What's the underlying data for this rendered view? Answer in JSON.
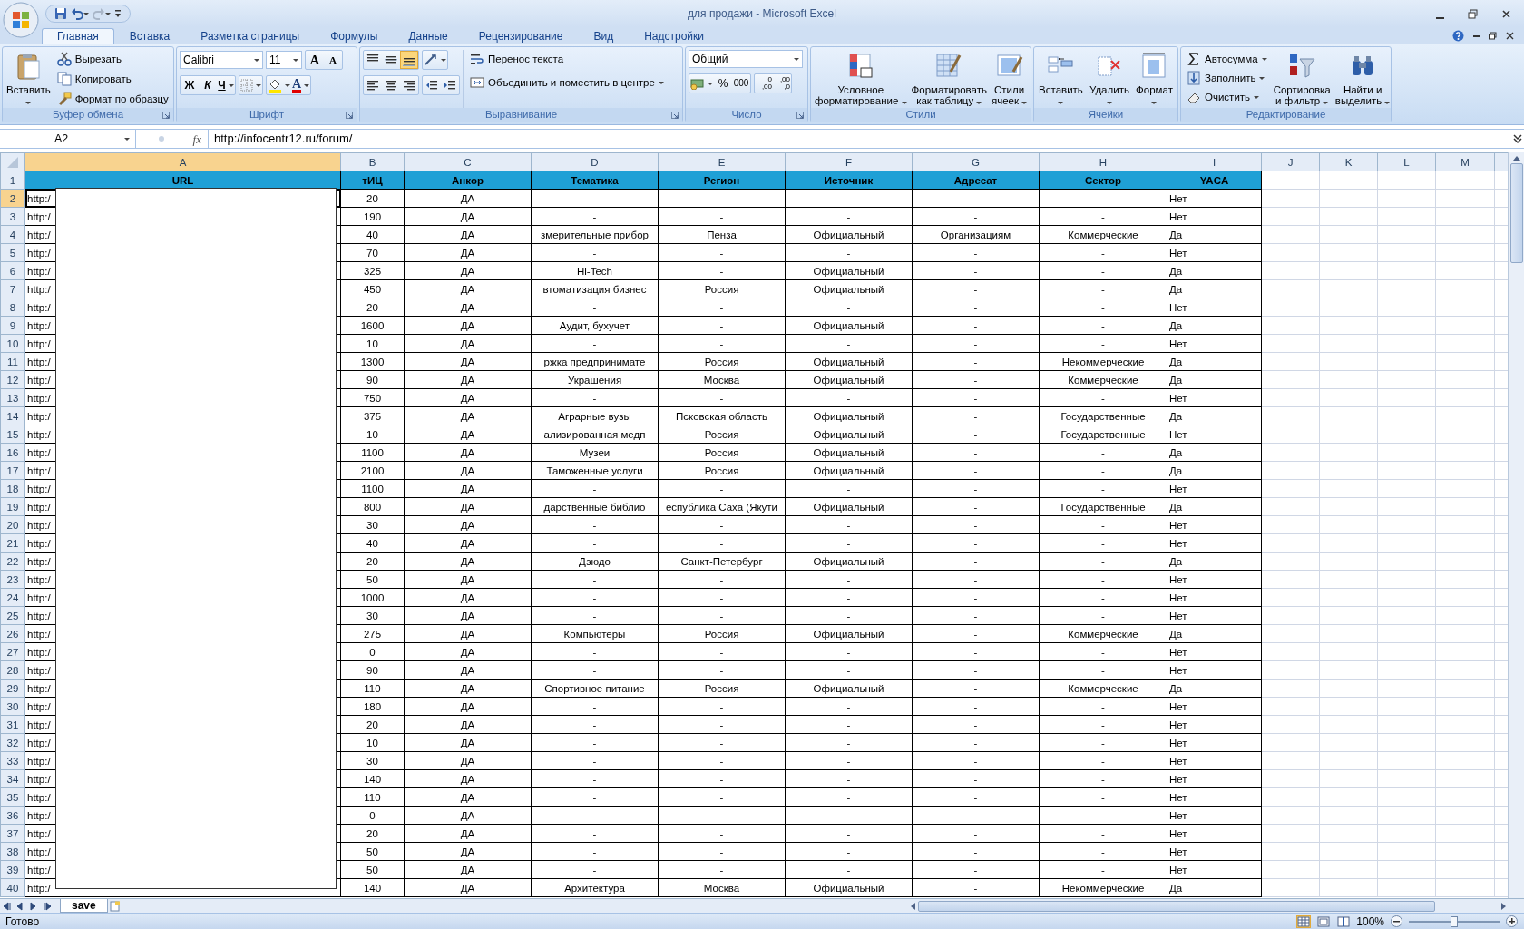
{
  "title_bar": {
    "title": "для продажи - Microsoft Excel"
  },
  "tabs": [
    {
      "label": "Главная",
      "selected": true
    },
    {
      "label": "Вставка",
      "selected": false
    },
    {
      "label": "Разметка страницы",
      "selected": false
    },
    {
      "label": "Формулы",
      "selected": false
    },
    {
      "label": "Данные",
      "selected": false
    },
    {
      "label": "Рецензирование",
      "selected": false
    },
    {
      "label": "Вид",
      "selected": false
    },
    {
      "label": "Надстройки",
      "selected": false
    }
  ],
  "ribbon": {
    "clipboard": {
      "label": "Буфер обмена",
      "paste": "Вставить",
      "commands": [
        "Вырезать",
        "Копировать",
        "Формат по образцу"
      ]
    },
    "font": {
      "label": "Шрифт",
      "font_name": "Calibri",
      "font_size": "11",
      "grow": "A",
      "shrink": "A",
      "bold": "Ж",
      "italic": "К",
      "underline": "Ч",
      "color_letter": "A"
    },
    "alignment": {
      "label": "Выравнивание",
      "vertical_align": [
        {
          "selected": false
        },
        {
          "selected": false
        },
        {
          "selected": true
        }
      ],
      "wrap": "Перенос текста",
      "merge": "Объединить и поместить в центре"
    },
    "number": {
      "label": "Число",
      "format": "Общий",
      "percent": "%",
      "thousands": "000",
      "increase": [
        ",0",
        ",00"
      ],
      "decrease": [
        ",00",
        ",0"
      ]
    },
    "styles": {
      "label": "Стили",
      "commands": [
        [
          "Условное",
          "форматирование"
        ],
        [
          "Форматировать",
          "как таблицу"
        ],
        [
          "Стили",
          "ячеек"
        ]
      ]
    },
    "cells": {
      "label": "Ячейки",
      "commands": [
        "Вставить",
        "Удалить",
        "Формат"
      ]
    },
    "editing": {
      "label": "Редактирование",
      "commands": [
        "Автосумма",
        "Заполнить",
        "Очистить"
      ],
      "large": [
        [
          "Сортировка",
          "и фильтр"
        ],
        [
          "Найти и",
          "выделить"
        ]
      ]
    }
  },
  "formula_bar": {
    "name_box": "A2",
    "fx": "fx",
    "value": "http://infocentr12.ru/forum/"
  },
  "columns": [
    {
      "label": "A",
      "selected": true
    },
    {
      "label": "B",
      "selected": false
    },
    {
      "label": "C",
      "selected": false
    },
    {
      "label": "D",
      "selected": false
    },
    {
      "label": "E",
      "selected": false
    },
    {
      "label": "F",
      "selected": false
    },
    {
      "label": "G",
      "selected": false
    },
    {
      "label": "H",
      "selected": false
    },
    {
      "label": "I",
      "selected": false
    },
    {
      "label": "J",
      "selected": false
    },
    {
      "label": "K",
      "selected": false
    },
    {
      "label": "L",
      "selected": false
    },
    {
      "label": "M",
      "selected": false
    }
  ],
  "header_row": {
    "number": "1",
    "cells": [
      "URL",
      "тИЦ",
      "Анкор",
      "Тематика",
      "Регион",
      "Источник",
      "Адресат",
      "Сектор",
      "YACA"
    ]
  },
  "rows": [
    {
      "number": "2",
      "selected": true,
      "cells": [
        "http:/",
        "20",
        "ДА",
        "-",
        "-",
        "-",
        "-",
        "-",
        "Нет"
      ]
    },
    {
      "number": "3",
      "selected": false,
      "cells": [
        "http:/",
        "190",
        "ДА",
        "-",
        "-",
        "-",
        "-",
        "-",
        "Нет"
      ]
    },
    {
      "number": "4",
      "selected": false,
      "cells": [
        "http:/",
        "40",
        "ДА",
        "змерительные прибор",
        "Пенза",
        "Официальный",
        "Организациям",
        "Коммерческие",
        "Да"
      ]
    },
    {
      "number": "5",
      "selected": false,
      "cells": [
        "http:/",
        "70",
        "ДА",
        "-",
        "-",
        "-",
        "-",
        "-",
        "Нет"
      ]
    },
    {
      "number": "6",
      "selected": false,
      "cells": [
        "http:/",
        "325",
        "ДА",
        "Hi-Tech",
        "-",
        "Официальный",
        "-",
        "-",
        "Да"
      ]
    },
    {
      "number": "7",
      "selected": false,
      "cells": [
        "http:/",
        "450",
        "ДА",
        "втоматизация бизнес",
        "Россия",
        "Официальный",
        "-",
        "-",
        "Да"
      ]
    },
    {
      "number": "8",
      "selected": false,
      "cells": [
        "http:/",
        "20",
        "ДА",
        "-",
        "-",
        "-",
        "-",
        "-",
        "Нет"
      ]
    },
    {
      "number": "9",
      "selected": false,
      "cells": [
        "http:/",
        "1600",
        "ДА",
        "Аудит, бухучет",
        "-",
        "Официальный",
        "-",
        "-",
        "Да"
      ]
    },
    {
      "number": "10",
      "selected": false,
      "cells": [
        "http:/",
        "10",
        "ДА",
        "-",
        "-",
        "-",
        "-",
        "-",
        "Нет"
      ]
    },
    {
      "number": "11",
      "selected": false,
      "cells": [
        "http:/",
        "1300",
        "ДА",
        "ржка предпринимате",
        "Россия",
        "Официальный",
        "-",
        "Некоммерческие",
        "Да"
      ]
    },
    {
      "number": "12",
      "selected": false,
      "cells": [
        "http:/",
        "90",
        "ДА",
        "Украшения",
        "Москва",
        "Официальный",
        "-",
        "Коммерческие",
        "Да"
      ]
    },
    {
      "number": "13",
      "selected": false,
      "cells": [
        "http:/",
        "750",
        "ДА",
        "-",
        "-",
        "-",
        "-",
        "-",
        "Нет"
      ]
    },
    {
      "number": "14",
      "selected": false,
      "cells": [
        "http:/",
        "375",
        "ДА",
        "Аграрные вузы",
        "Псковская область",
        "Официальный",
        "-",
        "Государственные",
        "Да"
      ]
    },
    {
      "number": "15",
      "selected": false,
      "cells": [
        "http:/",
        "10",
        "ДА",
        "ализированная медп",
        "Россия",
        "Официальный",
        "-",
        "Государственные",
        "Нет"
      ]
    },
    {
      "number": "16",
      "selected": false,
      "cells": [
        "http:/",
        "1100",
        "ДА",
        "Музеи",
        "Россия",
        "Официальный",
        "-",
        "-",
        "Да"
      ]
    },
    {
      "number": "17",
      "selected": false,
      "cells": [
        "http:/",
        "2100",
        "ДА",
        "Таможенные услуги",
        "Россия",
        "Официальный",
        "-",
        "-",
        "Да"
      ]
    },
    {
      "number": "18",
      "selected": false,
      "cells": [
        "http:/",
        "1100",
        "ДА",
        "-",
        "-",
        "-",
        "-",
        "-",
        "Нет"
      ]
    },
    {
      "number": "19",
      "selected": false,
      "cells": [
        "http:/",
        "800",
        "ДА",
        "дарственные  библио",
        "еспублика Саха (Якути",
        "Официальный",
        "-",
        "Государственные",
        "Да"
      ]
    },
    {
      "number": "20",
      "selected": false,
      "cells": [
        "http:/",
        "30",
        "ДА",
        "-",
        "-",
        "-",
        "-",
        "-",
        "Нет"
      ]
    },
    {
      "number": "21",
      "selected": false,
      "cells": [
        "http:/",
        "40",
        "ДА",
        "-",
        "-",
        "-",
        "-",
        "-",
        "Нет"
      ]
    },
    {
      "number": "22",
      "selected": false,
      "cells": [
        "http:/",
        "20",
        "ДА",
        "Дзюдо",
        "Санкт-Петербург",
        "Официальный",
        "-",
        "-",
        "Да"
      ]
    },
    {
      "number": "23",
      "selected": false,
      "cells": [
        "http:/",
        "50",
        "ДА",
        "-",
        "-",
        "-",
        "-",
        "-",
        "Нет"
      ]
    },
    {
      "number": "24",
      "selected": false,
      "cells": [
        "http:/",
        "1000",
        "ДА",
        "-",
        "-",
        "-",
        "-",
        "-",
        "Нет"
      ]
    },
    {
      "number": "25",
      "selected": false,
      "cells": [
        "http:/",
        "30",
        "ДА",
        "-",
        "-",
        "-",
        "-",
        "-",
        "Нет"
      ]
    },
    {
      "number": "26",
      "selected": false,
      "cells": [
        "http:/",
        "275",
        "ДА",
        "Компьютеры",
        "Россия",
        "Официальный",
        "-",
        "Коммерческие",
        "Да"
      ]
    },
    {
      "number": "27",
      "selected": false,
      "cells": [
        "http:/",
        "0",
        "ДА",
        "-",
        "-",
        "-",
        "-",
        "-",
        "Нет"
      ]
    },
    {
      "number": "28",
      "selected": false,
      "cells": [
        "http:/",
        "90",
        "ДА",
        "-",
        "-",
        "-",
        "-",
        "-",
        "Нет"
      ]
    },
    {
      "number": "29",
      "selected": false,
      "cells": [
        "http:/",
        "110",
        "ДА",
        "Спортивное питание",
        "Россия",
        "Официальный",
        "-",
        "Коммерческие",
        "Да"
      ]
    },
    {
      "number": "30",
      "selected": false,
      "cells": [
        "http:/",
        "180",
        "ДА",
        "-",
        "-",
        "-",
        "-",
        "-",
        "Нет"
      ]
    },
    {
      "number": "31",
      "selected": false,
      "cells": [
        "http:/",
        "20",
        "ДА",
        "-",
        "-",
        "-",
        "-",
        "-",
        "Нет"
      ]
    },
    {
      "number": "32",
      "selected": false,
      "cells": [
        "http:/",
        "10",
        "ДА",
        "-",
        "-",
        "-",
        "-",
        "-",
        "Нет"
      ]
    },
    {
      "number": "33",
      "selected": false,
      "cells": [
        "http:/",
        "30",
        "ДА",
        "-",
        "-",
        "-",
        "-",
        "-",
        "Нет"
      ]
    },
    {
      "number": "34",
      "selected": false,
      "cells": [
        "http:/",
        "140",
        "ДА",
        "-",
        "-",
        "-",
        "-",
        "-",
        "Нет"
      ]
    },
    {
      "number": "35",
      "selected": false,
      "cells": [
        "http:/",
        "110",
        "ДА",
        "-",
        "-",
        "-",
        "-",
        "-",
        "Нет"
      ]
    },
    {
      "number": "36",
      "selected": false,
      "cells": [
        "http:/",
        "0",
        "ДА",
        "-",
        "-",
        "-",
        "-",
        "-",
        "Нет"
      ]
    },
    {
      "number": "37",
      "selected": false,
      "cells": [
        "http:/",
        "20",
        "ДА",
        "-",
        "-",
        "-",
        "-",
        "-",
        "Нет"
      ]
    },
    {
      "number": "38",
      "selected": false,
      "cells": [
        "http:/",
        "50",
        "ДА",
        "-",
        "-",
        "-",
        "-",
        "-",
        "Нет"
      ]
    },
    {
      "number": "39",
      "selected": false,
      "cells": [
        "http:/",
        "50",
        "ДА",
        "-",
        "-",
        "-",
        "-",
        "-",
        "Нет"
      ]
    },
    {
      "number": "40",
      "selected": false,
      "cells": [
        "http:/",
        "140",
        "ДА",
        "Архитектура",
        "Москва",
        "Официальный",
        "-",
        "Некоммерческие",
        "Да"
      ]
    }
  ],
  "sheet_tabs": [
    {
      "label": "save",
      "selected": true
    }
  ],
  "status_bar": {
    "text": "Готово",
    "views": [
      {
        "selected": true
      },
      {
        "selected": false
      },
      {
        "selected": false
      }
    ],
    "zoom": "100%",
    "zoom_slider": {
      "level": 0.5
    }
  }
}
